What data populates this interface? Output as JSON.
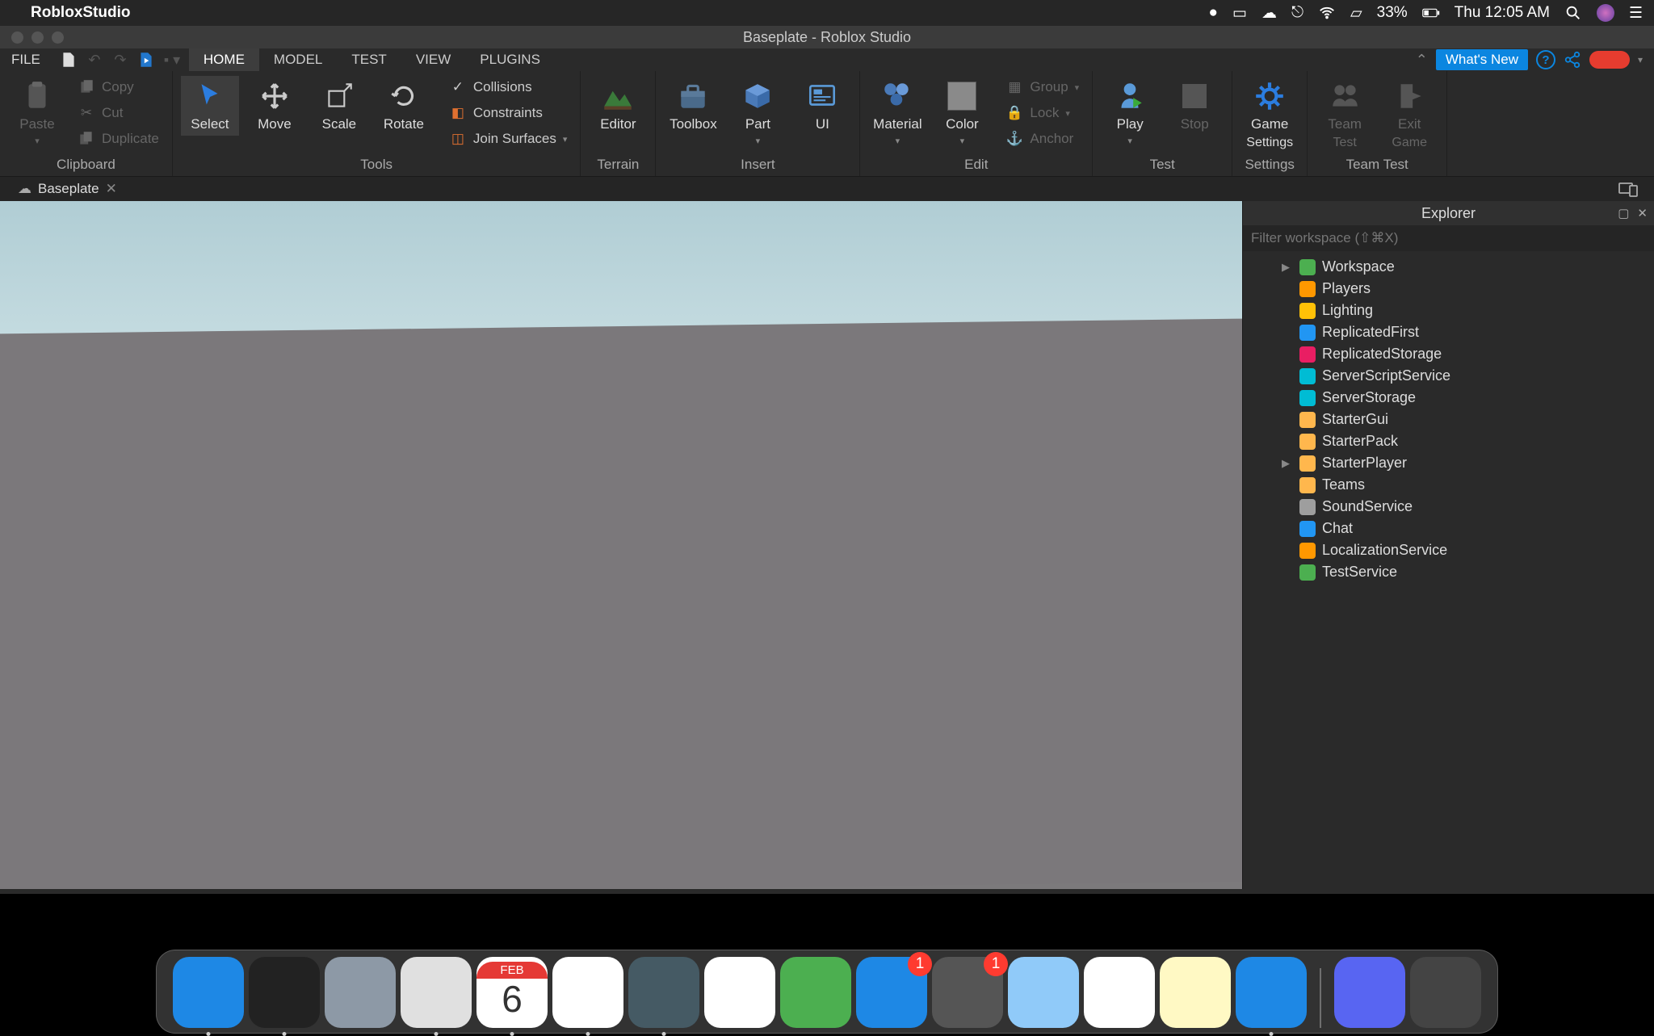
{
  "menubar": {
    "app_name": "RobloxStudio",
    "battery_pct": "33%",
    "clock": "Thu 12:05 AM"
  },
  "window": {
    "title": "Baseplate - Roblox Studio"
  },
  "file_tab": "FILE",
  "ribbon_tabs": [
    "HOME",
    "MODEL",
    "TEST",
    "VIEW",
    "PLUGINS"
  ],
  "active_ribbon_tab": 0,
  "whats_new": "What's New",
  "ribbon": {
    "clipboard": {
      "label": "Clipboard",
      "paste": "Paste",
      "copy": "Copy",
      "cut": "Cut",
      "duplicate": "Duplicate"
    },
    "tools": {
      "label": "Tools",
      "select": "Select",
      "move": "Move",
      "scale": "Scale",
      "rotate": "Rotate",
      "collisions": "Collisions",
      "constraints": "Constraints",
      "join": "Join Surfaces"
    },
    "terrain": {
      "label": "Terrain",
      "editor": "Editor"
    },
    "insert": {
      "label": "Insert",
      "toolbox": "Toolbox",
      "part": "Part",
      "ui": "UI"
    },
    "edit": {
      "label": "Edit",
      "material": "Material",
      "color": "Color",
      "group": "Group",
      "lock": "Lock",
      "anchor": "Anchor"
    },
    "test": {
      "label": "Test",
      "play": "Play",
      "stop": "Stop"
    },
    "settings": {
      "label": "Settings",
      "game": "Game",
      "settings": "Settings"
    },
    "teamtest": {
      "label": "Team Test",
      "teamtest": "Team",
      "test": "Test",
      "exit": "Exit",
      "game": "Game"
    }
  },
  "doc_tab": "Baseplate",
  "explorer": {
    "title": "Explorer",
    "filter_placeholder": "Filter workspace (⇧⌘X)",
    "items": [
      {
        "name": "Workspace",
        "icon": "globe",
        "color": "#4caf50",
        "expandable": true
      },
      {
        "name": "Players",
        "icon": "person",
        "color": "#ff9800"
      },
      {
        "name": "Lighting",
        "icon": "bulb",
        "color": "#ffc107"
      },
      {
        "name": "ReplicatedFirst",
        "icon": "box",
        "color": "#2196f3"
      },
      {
        "name": "ReplicatedStorage",
        "icon": "box",
        "color": "#e91e63"
      },
      {
        "name": "ServerScriptService",
        "icon": "gear",
        "color": "#00bcd4"
      },
      {
        "name": "ServerStorage",
        "icon": "box",
        "color": "#00bcd4"
      },
      {
        "name": "StarterGui",
        "icon": "folder",
        "color": "#ffb74d"
      },
      {
        "name": "StarterPack",
        "icon": "folder",
        "color": "#ffb74d"
      },
      {
        "name": "StarterPlayer",
        "icon": "folder",
        "color": "#ffb74d",
        "expandable": true
      },
      {
        "name": "Teams",
        "icon": "folder",
        "color": "#ffb74d"
      },
      {
        "name": "SoundService",
        "icon": "sound",
        "color": "#9e9e9e"
      },
      {
        "name": "Chat",
        "icon": "chat",
        "color": "#2196f3"
      },
      {
        "name": "LocalizationService",
        "icon": "globe",
        "color": "#ff9800"
      },
      {
        "name": "TestService",
        "icon": "check",
        "color": "#4caf50"
      }
    ]
  },
  "dock": {
    "items": [
      {
        "name": "finder",
        "color": "#1e88e5",
        "running": true
      },
      {
        "name": "siri",
        "color": "#222",
        "running": true
      },
      {
        "name": "launchpad",
        "color": "#8d99a6"
      },
      {
        "name": "safari",
        "color": "#e0e0e0",
        "running": true
      },
      {
        "name": "calendar",
        "color": "#fff",
        "running": true,
        "text": "6",
        "top": "FEB"
      },
      {
        "name": "chrome",
        "color": "#fff",
        "running": true
      },
      {
        "name": "quicktime",
        "color": "#455a64",
        "running": true
      },
      {
        "name": "photos",
        "color": "#fff"
      },
      {
        "name": "facetime",
        "color": "#4caf50"
      },
      {
        "name": "appstore",
        "color": "#1e88e5",
        "badge": "1"
      },
      {
        "name": "settings",
        "color": "#555",
        "badge": "1"
      },
      {
        "name": "preview",
        "color": "#90caf9"
      },
      {
        "name": "music",
        "color": "#fff"
      },
      {
        "name": "notes",
        "color": "#fff9c4"
      },
      {
        "name": "robloxstudio",
        "color": "#1e88e5",
        "running": true
      }
    ],
    "right": [
      {
        "name": "discord",
        "color": "#5865f2"
      },
      {
        "name": "trash",
        "color": "#444"
      }
    ]
  }
}
